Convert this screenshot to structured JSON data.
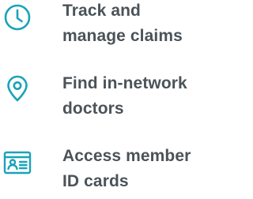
{
  "features": [
    {
      "icon": "clock-icon",
      "line1": "Track and",
      "line2": "manage claims"
    },
    {
      "icon": "location-pin-icon",
      "line1": "Find in-network",
      "line2": "doctors"
    },
    {
      "icon": "id-card-icon",
      "line1": "Access member",
      "line2": "ID cards"
    }
  ],
  "colors": {
    "icon": "#1aa3b8",
    "text": "#4a5359"
  }
}
